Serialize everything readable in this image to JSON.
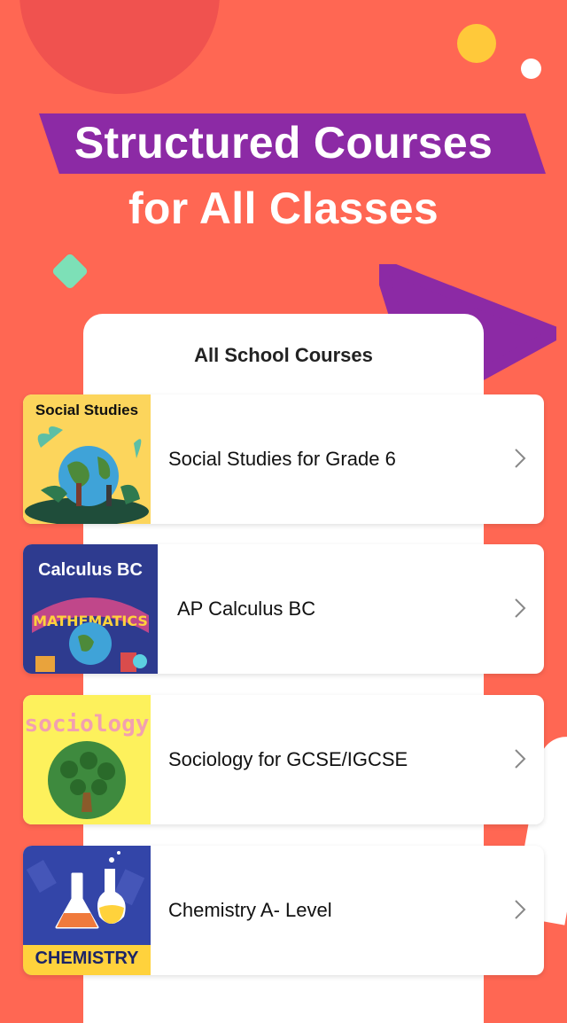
{
  "headline": {
    "line1": "Structured Courses",
    "line2": "for All Classes"
  },
  "sheet": {
    "title": "All School Courses"
  },
  "courses": [
    {
      "label": "Social Studies for Grade 6",
      "thumb_title": "Social Studies",
      "thumb_color": "#fcd55c"
    },
    {
      "label": "AP Calculus BC",
      "thumb_title": "Calculus BC",
      "thumb_sub": "MATHEMATICS",
      "thumb_color": "#2e3b8f"
    },
    {
      "label": "Sociology for GCSE/IGCSE",
      "thumb_title": "sociology",
      "thumb_color": "#fdf15c"
    },
    {
      "label": "Chemistry A- Level",
      "thumb_title": "CHEMISTRY",
      "thumb_color": "#3345a8"
    }
  ],
  "colors": {
    "background": "#ff6753",
    "headline_band": "#8c2aa5",
    "accent_yellow": "#ffc93a",
    "accent_green": "#7de0b7"
  },
  "icons": [
    "chevron-right-icon",
    "globe-icon",
    "flask-icon",
    "tree-icon"
  ]
}
